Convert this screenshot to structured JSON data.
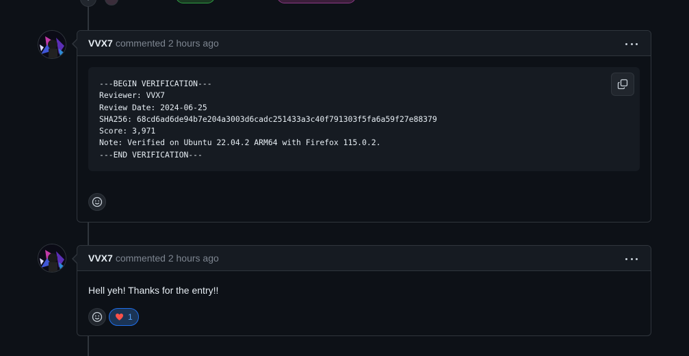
{
  "timeline": {
    "items": [
      {
        "author": "VVX7",
        "meta": "commented 2 hours ago",
        "code_lines": [
          "---BEGIN VERIFICATION---",
          "Reviewer: VVX7",
          "Review Date: 2024-06-25",
          "SHA256: 68cd6ad6de94b7e204a3003d6cadc251433a3c40f791303f5fa6a59f27e88379",
          "Score: 3,971",
          "Note: Verified on Ubuntu 22.04.2 ARM64 with Firefox 115.0.2.",
          "---END VERIFICATION---"
        ]
      },
      {
        "author": "VVX7",
        "meta": "commented 2 hours ago",
        "text": "Hell yeh! Thanks for the entry!!",
        "reactions": [
          {
            "emoji": "heart-icon",
            "count": "1"
          }
        ]
      }
    ]
  },
  "colors": {
    "background": "#0d1117",
    "border": "#30363d",
    "header_bg": "#161b22",
    "accent_blue": "#58a6ff",
    "heart": "#f85149"
  }
}
